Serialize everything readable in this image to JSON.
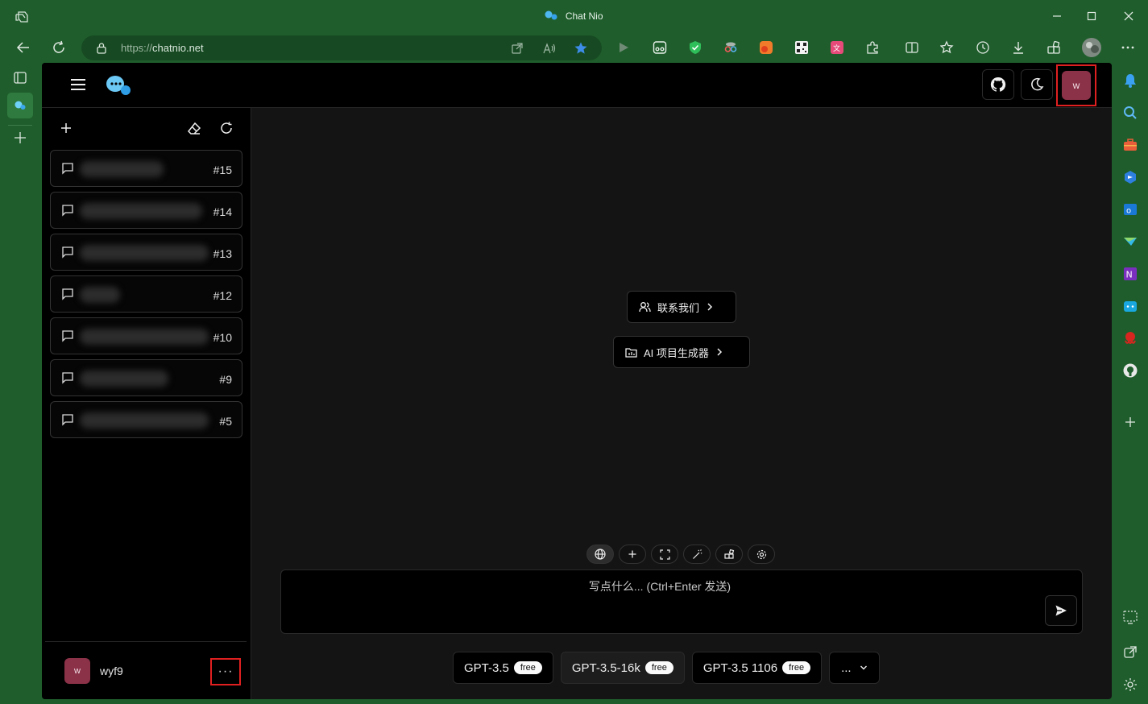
{
  "window": {
    "title": "Chat Nio"
  },
  "browser": {
    "url_prefix": "https://",
    "url_host": "chatnio.net"
  },
  "header": {
    "avatar_letter": "w"
  },
  "sidebar": {
    "conversations": [
      {
        "number": "#15",
        "blur_width": 104
      },
      {
        "number": "#14",
        "blur_width": 152
      },
      {
        "number": "#13",
        "blur_width": 160
      },
      {
        "number": "#12",
        "blur_width": 50
      },
      {
        "number": "#10",
        "blur_width": 160
      },
      {
        "number": "#9",
        "blur_width": 110
      },
      {
        "number": "#5",
        "blur_width": 160
      }
    ],
    "user": {
      "avatar_letter": "w",
      "name": "wyf9",
      "more_label": "···"
    }
  },
  "main": {
    "contact_label": "联系我们",
    "project_label": "AI 项目生成器",
    "input_placeholder": "写点什么... (Ctrl+Enter 发送)",
    "models": [
      {
        "name": "GPT-3.5",
        "badge": "free",
        "active": false
      },
      {
        "name": "GPT-3.5-16k",
        "badge": "free",
        "active": true
      },
      {
        "name": "GPT-3.5 1106",
        "badge": "free",
        "active": false
      }
    ],
    "more_models_label": "..."
  },
  "colors": {
    "accent_avatar": "#8b3148",
    "highlight_box": "#e02020",
    "browser_chrome": "#1f5e2c"
  }
}
